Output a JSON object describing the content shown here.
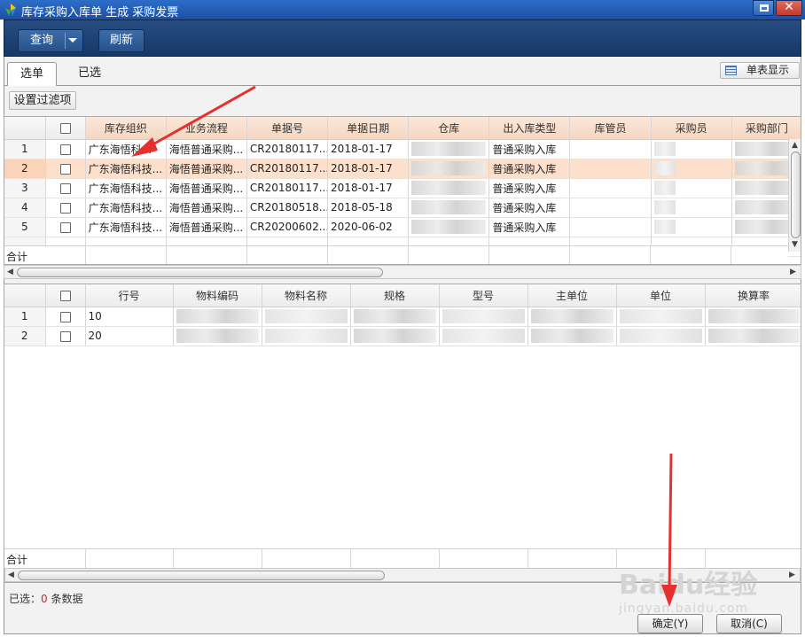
{
  "window": {
    "title": "库存采购入库单 生成  采购发票"
  },
  "toolbar": {
    "query_label": "查询",
    "refresh_label": "刷新"
  },
  "tabs": [
    {
      "label": "选单"
    },
    {
      "label": "已选"
    }
  ],
  "single_view_label": "单表显示",
  "filter_button_label": "设置过滤项",
  "grid1": {
    "columns": [
      "库存组织",
      "业务流程",
      "单据号",
      "单据日期",
      "仓库",
      "出入库类型",
      "库管员",
      "采购员",
      "采购部门"
    ],
    "rows": [
      {
        "rn": "1",
        "org": "广东海悟科...",
        "flow": "海悟普通采购...",
        "billno": "CR20180117...",
        "date": "2018-01-17",
        "type": "普通采购入库"
      },
      {
        "rn": "2",
        "org": "广东海悟科技...",
        "flow": "海悟普通采购...",
        "billno": "CR20180117...",
        "date": "2018-01-17",
        "type": "普通采购入库"
      },
      {
        "rn": "3",
        "org": "广东海悟科技...",
        "flow": "海悟普通采购...",
        "billno": "CR20180117...",
        "date": "2018-01-17",
        "type": "普通采购入库"
      },
      {
        "rn": "4",
        "org": "广东海悟科技...",
        "flow": "海悟普通采购...",
        "billno": "CR20180518...",
        "date": "2018-05-18",
        "type": "普通采购入库"
      },
      {
        "rn": "5",
        "org": "广东海悟科技...",
        "flow": "海悟普通采购...",
        "billno": "CR20200602...",
        "date": "2020-06-02",
        "type": "普通采购入库"
      }
    ],
    "total_label": "合计"
  },
  "grid2": {
    "columns": [
      "行号",
      "物料编码",
      "物料名称",
      "规格",
      "型号",
      "主单位",
      "单位",
      "换算率"
    ],
    "rows": [
      {
        "rn": "1",
        "line": "10"
      },
      {
        "rn": "2",
        "line": "20"
      }
    ],
    "total_label": "合计"
  },
  "status": {
    "prefix": "已选：",
    "count": "0",
    "suffix": " 条数据"
  },
  "buttons": {
    "ok_label": "确定(Y)",
    "cancel_label": "取消(C)"
  },
  "watermark": {
    "main": "Baidu经验",
    "sub": "jingyan.baidu.com"
  },
  "colors": {
    "titlebar": "#1f56ab",
    "toolbar": "#1e4373",
    "selected_row": "#fde0cc",
    "status_count": "#e02020",
    "annotation_arrow": "#e53030"
  }
}
